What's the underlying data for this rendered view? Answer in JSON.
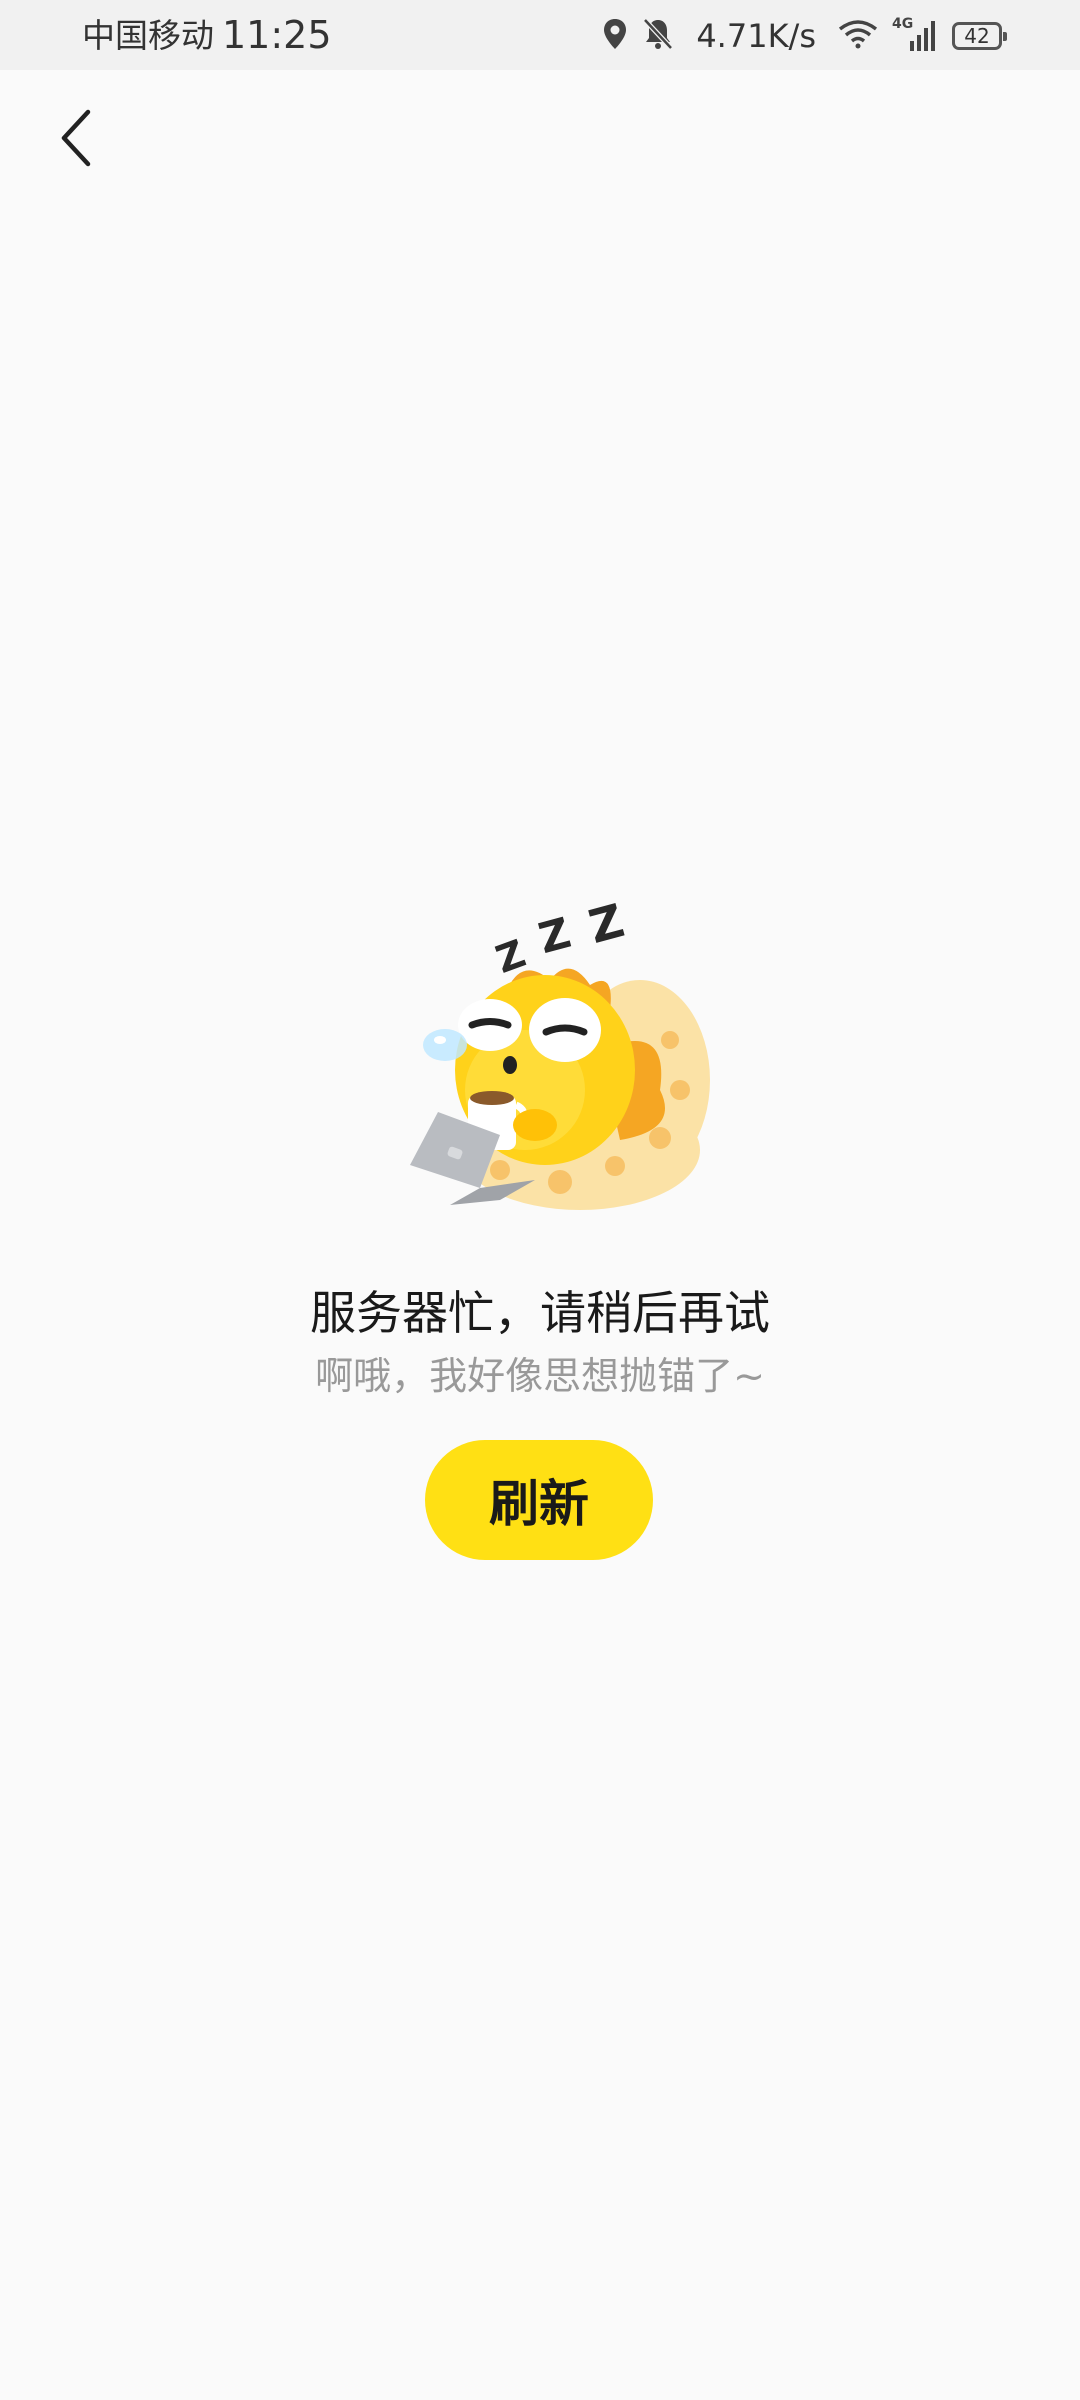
{
  "status_bar": {
    "carrier": "中国移动",
    "time": "11:25",
    "net_speed": "4.71K/s",
    "network_type": "4G",
    "battery": "42",
    "icons": [
      "location-icon",
      "bell-muted-icon",
      "wifi-icon",
      "signal-icon",
      "battery-icon"
    ]
  },
  "nav": {
    "back_icon": "chevron-left-icon"
  },
  "empty_state": {
    "illustration": "sleeping-yellow-mascot",
    "title": "服务器忙，请稍后再试",
    "subtitle": "啊哦，我好像思想抛锚了~",
    "refresh_label": "刷新"
  },
  "colors": {
    "accent": "#ffe014",
    "background": "#fafafa",
    "title_text": "#1a1a1a",
    "subtitle_text": "#999999"
  }
}
